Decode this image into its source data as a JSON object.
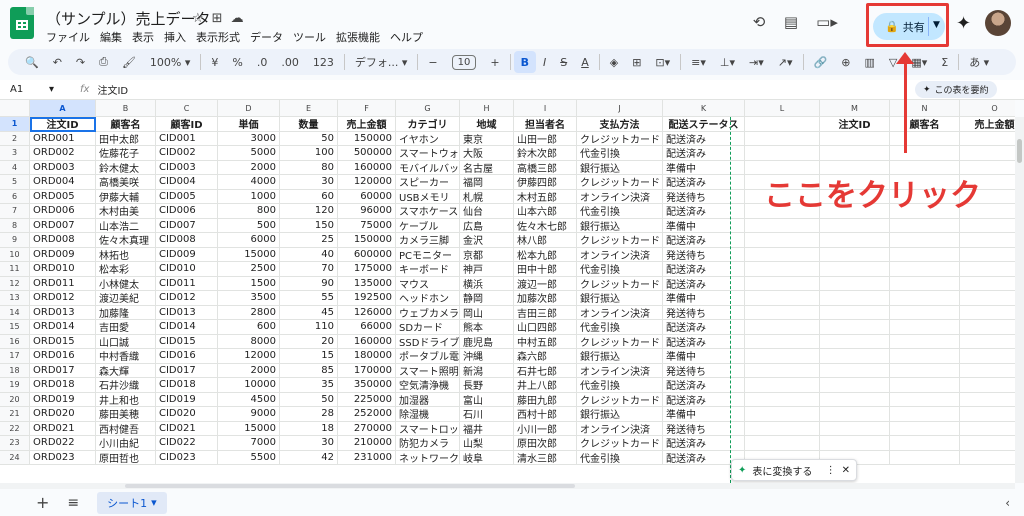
{
  "doc": {
    "title": "（サンプル）売上データ",
    "menus": [
      "ファイル",
      "編集",
      "表示",
      "挿入",
      "表示形式",
      "データ",
      "ツール",
      "拡張機能",
      "ヘルプ"
    ]
  },
  "header": {
    "share_label": "共有"
  },
  "toolbar": {
    "zoom": "100%",
    "currency": "¥",
    "percent": "%",
    "dec_dec": ".0",
    "inc_dec": ".00",
    "format_123": "123",
    "font": "デフォ...",
    "font_size": "10",
    "bold": "B",
    "italic": "I",
    "strike": "S",
    "text_color": "A",
    "input_tool": "あ"
  },
  "formula_bar": {
    "cell_ref": "A1",
    "fx": "fx",
    "content": "注文ID",
    "summarize_label": "この表を要約"
  },
  "columns": [
    "A",
    "B",
    "C",
    "D",
    "E",
    "F",
    "G",
    "H",
    "I",
    "J",
    "K",
    "L",
    "M",
    "N",
    "O"
  ],
  "header_row": [
    "注文ID",
    "顧客名",
    "顧客ID",
    "単価",
    "数量",
    "売上金額",
    "カテゴリ",
    "地域",
    "担当者名",
    "支払方法",
    "配送ステータス",
    "",
    "注文ID",
    "顧客名",
    "売上金額"
  ],
  "rows": [
    [
      "ORD001",
      "田中太郎",
      "CID001",
      "3000",
      "50",
      "150000",
      "イヤホン",
      "東京",
      "山田一郎",
      "クレジットカード",
      "配送済み"
    ],
    [
      "ORD002",
      "佐藤花子",
      "CID002",
      "5000",
      "100",
      "500000",
      "スマートウォッ",
      "大阪",
      "鈴木次郎",
      "代金引換",
      "配送済み"
    ],
    [
      "ORD003",
      "鈴木健太",
      "CID003",
      "2000",
      "80",
      "160000",
      "モバイルバッテ",
      "名古屋",
      "高橋三郎",
      "銀行振込",
      "準備中"
    ],
    [
      "ORD004",
      "高橋美咲",
      "CID004",
      "4000",
      "30",
      "120000",
      "スピーカー",
      "福岡",
      "伊藤四郎",
      "クレジットカード",
      "配送済み"
    ],
    [
      "ORD005",
      "伊藤大輔",
      "CID005",
      "1000",
      "60",
      "60000",
      "USBメモリ",
      "札幌",
      "木村五郎",
      "オンライン決済",
      "発送待ち"
    ],
    [
      "ORD006",
      "木村由美",
      "CID006",
      "800",
      "120",
      "96000",
      "スマホケース",
      "仙台",
      "山本六郎",
      "代金引換",
      "配送済み"
    ],
    [
      "ORD007",
      "山本浩二",
      "CID007",
      "500",
      "150",
      "75000",
      "ケーブル",
      "広島",
      "佐々木七郎",
      "銀行振込",
      "準備中"
    ],
    [
      "ORD008",
      "佐々木真理",
      "CID008",
      "6000",
      "25",
      "150000",
      "カメラ三脚",
      "金沢",
      "林八郎",
      "クレジットカード",
      "配送済み"
    ],
    [
      "ORD009",
      "林拓也",
      "CID009",
      "15000",
      "40",
      "600000",
      "PCモニター",
      "京都",
      "松本九郎",
      "オンライン決済",
      "発送待ち"
    ],
    [
      "ORD010",
      "松本彩",
      "CID010",
      "2500",
      "70",
      "175000",
      "キーボード",
      "神戸",
      "田中十郎",
      "代金引換",
      "配送済み"
    ],
    [
      "ORD011",
      "小林健太",
      "CID011",
      "1500",
      "90",
      "135000",
      "マウス",
      "横浜",
      "渡辺一郎",
      "クレジットカード",
      "配送済み"
    ],
    [
      "ORD012",
      "渡辺美紀",
      "CID012",
      "3500",
      "55",
      "192500",
      "ヘッドホン",
      "静岡",
      "加藤次郎",
      "銀行振込",
      "準備中"
    ],
    [
      "ORD013",
      "加藤隆",
      "CID013",
      "2800",
      "45",
      "126000",
      "ウェブカメラ",
      "岡山",
      "吉田三郎",
      "オンライン決済",
      "発送待ち"
    ],
    [
      "ORD014",
      "吉田愛",
      "CID014",
      "600",
      "110",
      "66000",
      "SDカード",
      "熊本",
      "山口四郎",
      "代金引換",
      "配送済み"
    ],
    [
      "ORD015",
      "山口誠",
      "CID015",
      "8000",
      "20",
      "160000",
      "SSDドライブ",
      "鹿児島",
      "中村五郎",
      "クレジットカード",
      "配送済み"
    ],
    [
      "ORD016",
      "中村香織",
      "CID016",
      "12000",
      "15",
      "180000",
      "ポータブル電源",
      "沖縄",
      "森六郎",
      "銀行振込",
      "準備中"
    ],
    [
      "ORD017",
      "森大輝",
      "CID017",
      "2000",
      "85",
      "170000",
      "スマート照明",
      "新潟",
      "石井七郎",
      "オンライン決済",
      "発送待ち"
    ],
    [
      "ORD018",
      "石井沙織",
      "CID018",
      "10000",
      "35",
      "350000",
      "空気清浄機",
      "長野",
      "井上八郎",
      "代金引換",
      "配送済み"
    ],
    [
      "ORD019",
      "井上和也",
      "CID019",
      "4500",
      "50",
      "225000",
      "加湿器",
      "富山",
      "藤田九郎",
      "クレジットカード",
      "配送済み"
    ],
    [
      "ORD020",
      "藤田美穂",
      "CID020",
      "9000",
      "28",
      "252000",
      "除湿機",
      "石川",
      "西村十郎",
      "銀行振込",
      "準備中"
    ],
    [
      "ORD021",
      "西村健吾",
      "CID021",
      "15000",
      "18",
      "270000",
      "スマートロック",
      "福井",
      "小川一郎",
      "オンライン決済",
      "発送待ち"
    ],
    [
      "ORD022",
      "小川由紀",
      "CID022",
      "7000",
      "30",
      "210000",
      "防犯カメラ",
      "山梨",
      "原田次郎",
      "クレジットカード",
      "配送済み"
    ],
    [
      "ORD023",
      "原田哲也",
      "CID023",
      "5500",
      "42",
      "231000",
      "ネットワークカ",
      "岐阜",
      "清水三郎",
      "代金引換",
      "配送済み"
    ]
  ],
  "annotation": {
    "text": "ここをクリック",
    "color": "#e53935"
  },
  "convert_chip": {
    "label": "表に変換する"
  },
  "sheet_tab": {
    "label": "シート1"
  }
}
